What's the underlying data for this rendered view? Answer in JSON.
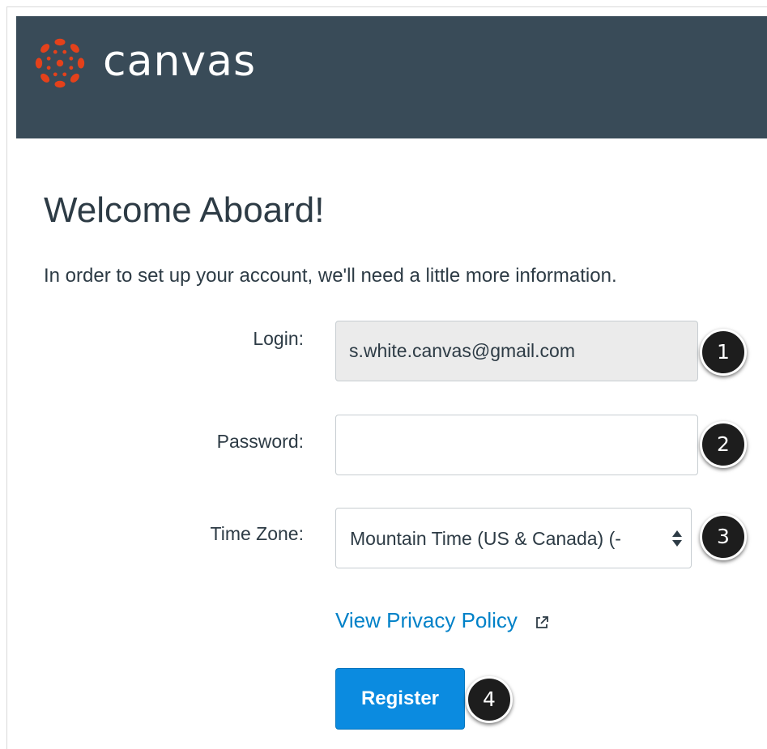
{
  "header": {
    "brand": "canvas",
    "logo_icon": "canvas-logo-icon",
    "background_color": "#394b58",
    "logo_color": "#e4411b"
  },
  "page": {
    "title": "Welcome Aboard!",
    "subtitle": "In order to set up your account, we'll need a little more information."
  },
  "form": {
    "login": {
      "label": "Login:",
      "value": "s.white.canvas@gmail.com"
    },
    "password": {
      "label": "Password:",
      "value": ""
    },
    "time_zone": {
      "label": "Time Zone:",
      "selected": "Mountain Time (US & Canada) (-"
    },
    "privacy_link": {
      "label": "View Privacy Policy",
      "icon": "external-link-icon",
      "color": "#0081c8"
    },
    "register": {
      "label": "Register",
      "color": "#0b8be0"
    }
  },
  "callouts": [
    "1",
    "2",
    "3",
    "4"
  ]
}
